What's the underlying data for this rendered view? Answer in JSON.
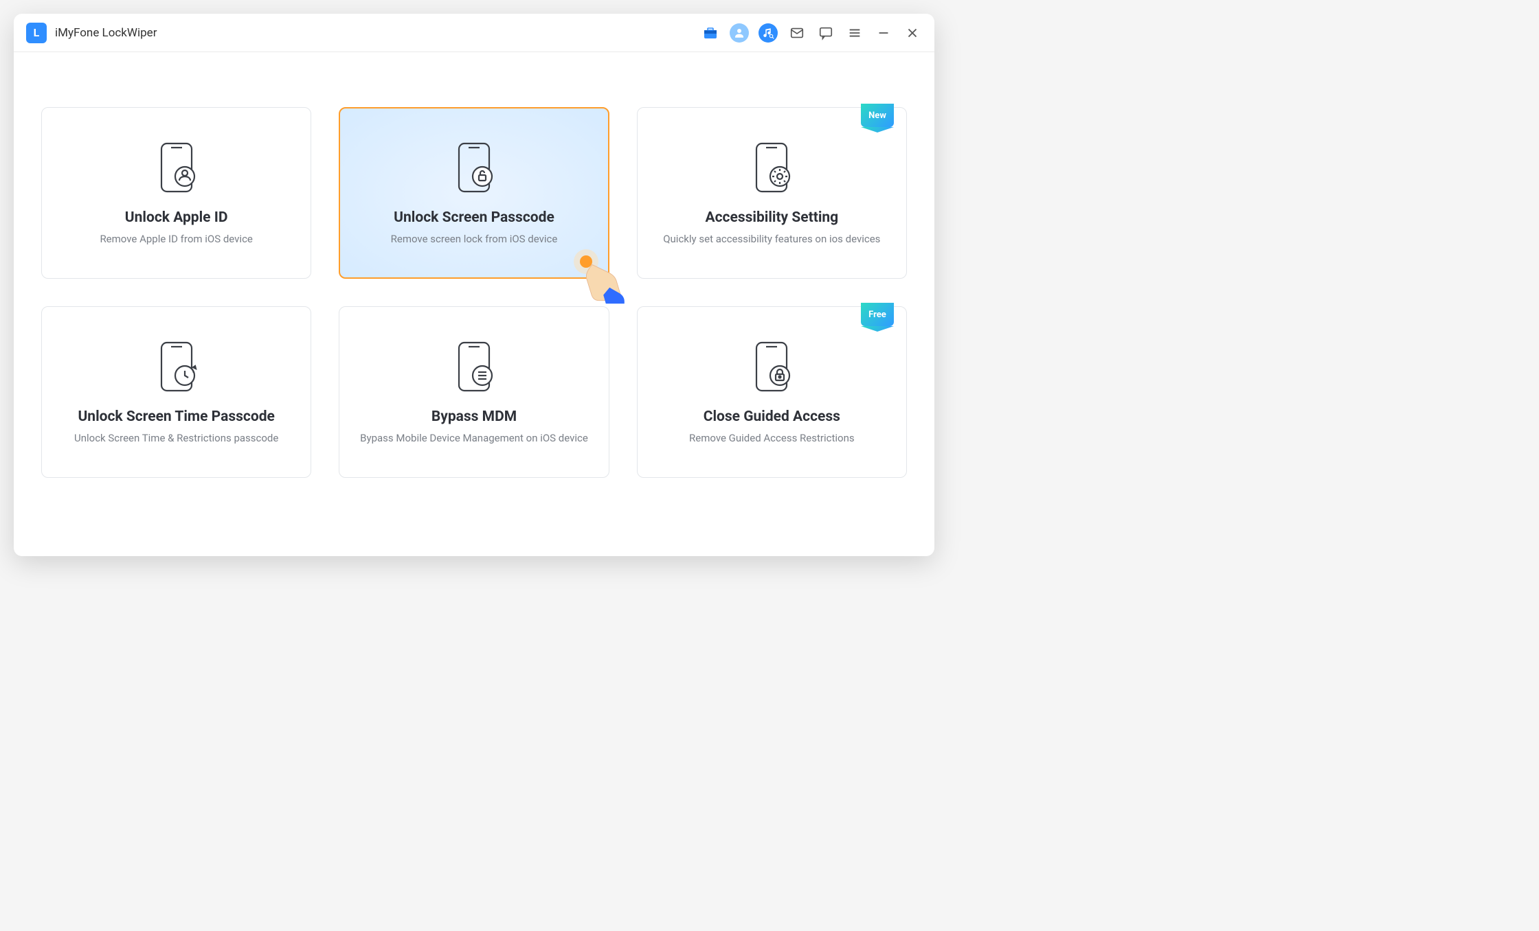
{
  "app": {
    "logo_letter": "L",
    "title": "iMyFone LockWiper"
  },
  "cards": [
    {
      "title": "Unlock Apple ID",
      "sub": "Remove Apple ID from iOS device",
      "selected": false
    },
    {
      "title": "Unlock Screen Passcode",
      "sub": "Remove screen lock from iOS device",
      "selected": true
    },
    {
      "title": "Accessibility Setting",
      "sub": "Quickly set accessibility features on ios devices",
      "badge": "New"
    },
    {
      "title": "Unlock Screen Time Passcode",
      "sub": "Unlock Screen Time & Restrictions passcode"
    },
    {
      "title": "Bypass MDM",
      "sub": "Bypass Mobile Device Management on iOS device"
    },
    {
      "title": "Close Guided Access",
      "sub": "Remove Guided Access Restrictions",
      "badge": "Free"
    }
  ]
}
